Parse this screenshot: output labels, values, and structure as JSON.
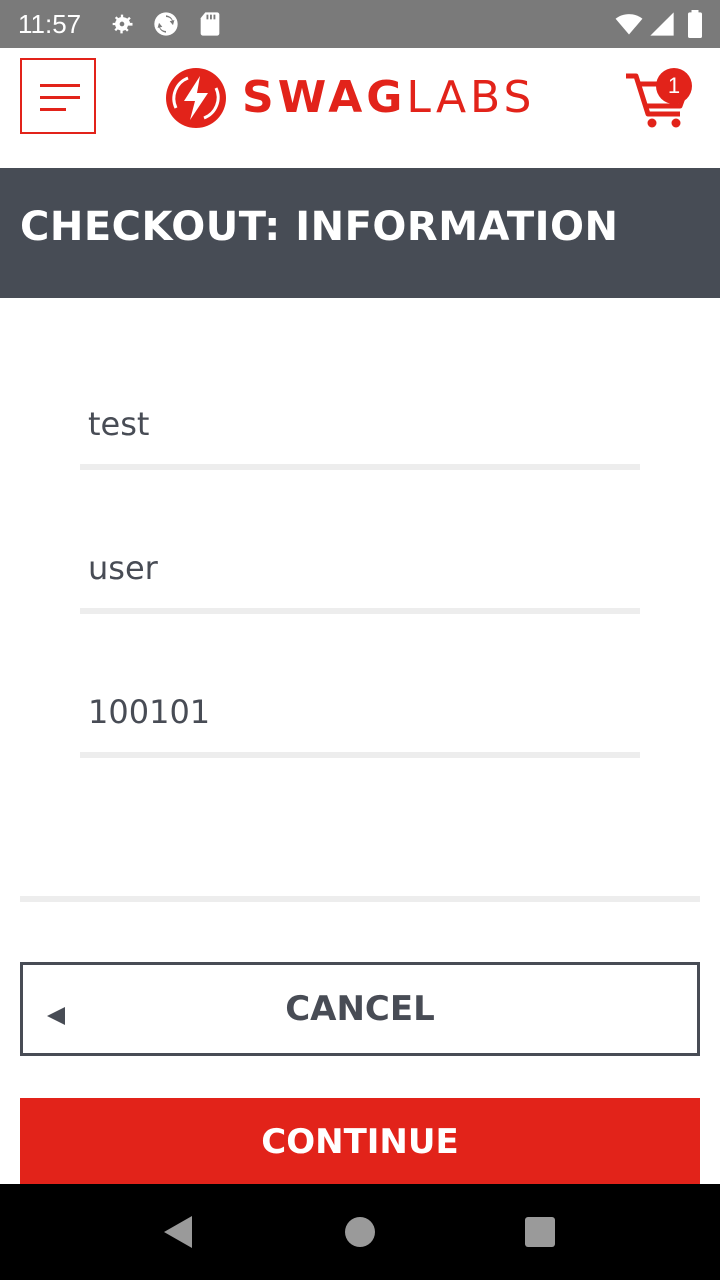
{
  "status_bar": {
    "time": "11:57",
    "icons": [
      "gear-icon",
      "sync-icon",
      "sd-card-icon",
      "wifi-icon",
      "signal-icon",
      "battery-icon"
    ]
  },
  "header": {
    "brand": {
      "bold": "SWAG",
      "light": "LABS"
    },
    "cart_count": "1",
    "accent_color": "#e2231a"
  },
  "subheader": {
    "title": "CHECKOUT: INFORMATION",
    "background": "#474c55"
  },
  "form": {
    "first_name": "test",
    "last_name": "user",
    "postal_code": "100101"
  },
  "actions": {
    "cancel_label": "CANCEL",
    "continue_label": "CONTINUE"
  },
  "nav": {
    "icons": [
      "back-icon",
      "home-icon",
      "recents-icon"
    ]
  }
}
